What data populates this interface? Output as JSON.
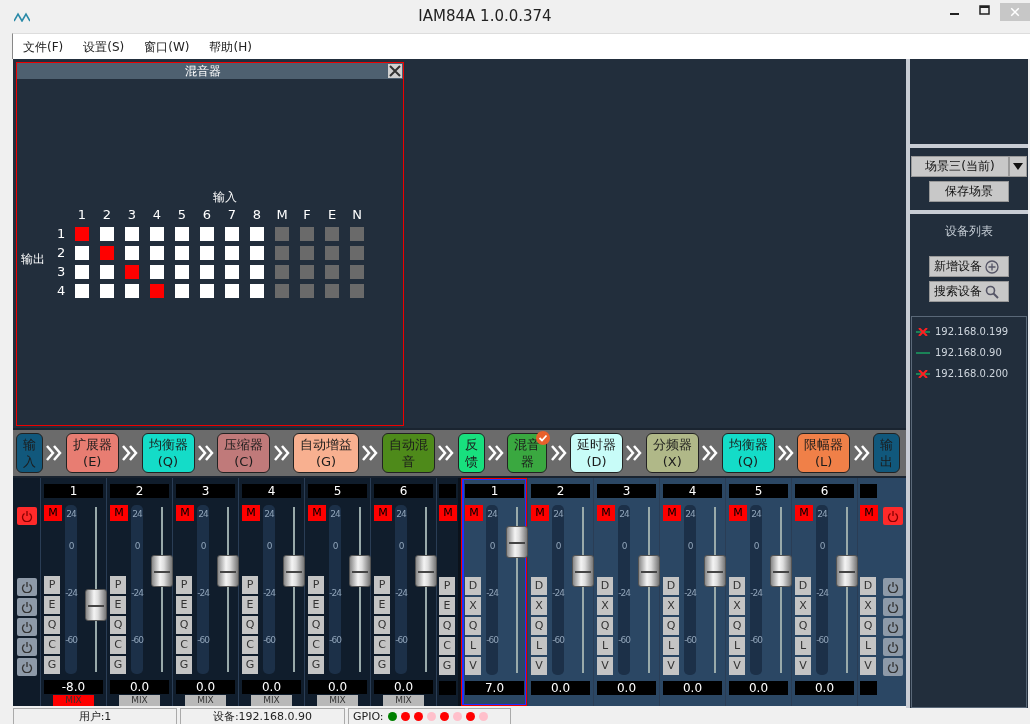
{
  "window": {
    "title": "IAM84A 1.0.0.374"
  },
  "menu": [
    "文件(F)",
    "设置(S)",
    "窗口(W)",
    "帮助(H)"
  ],
  "mixer_panel": {
    "title": "混音器",
    "input_label": "输入",
    "output_label": "输出",
    "columns": [
      "1",
      "2",
      "3",
      "4",
      "5",
      "6",
      "7",
      "8",
      "M",
      "F",
      "E",
      "N"
    ],
    "rows": [
      {
        "label": "1",
        "cells": [
          {
            "on": true,
            "disabled": false
          },
          {
            "on": false,
            "disabled": false
          },
          {
            "on": false,
            "disabled": false
          },
          {
            "on": false,
            "disabled": false
          },
          {
            "on": false,
            "disabled": false
          },
          {
            "on": false,
            "disabled": false
          },
          {
            "on": false,
            "disabled": false
          },
          {
            "on": false,
            "disabled": false
          },
          {
            "disabled": true
          },
          {
            "disabled": true
          },
          {
            "disabled": true
          },
          {
            "disabled": true
          }
        ]
      },
      {
        "label": "2",
        "cells": [
          {
            "on": false,
            "disabled": false
          },
          {
            "on": true,
            "disabled": false
          },
          {
            "on": false,
            "disabled": false
          },
          {
            "on": false,
            "disabled": false
          },
          {
            "on": false,
            "disabled": false
          },
          {
            "on": false,
            "disabled": false
          },
          {
            "on": false,
            "disabled": false
          },
          {
            "on": false,
            "disabled": false
          },
          {
            "disabled": true
          },
          {
            "disabled": true
          },
          {
            "disabled": true
          },
          {
            "disabled": true
          }
        ]
      },
      {
        "label": "3",
        "cells": [
          {
            "on": false,
            "disabled": false
          },
          {
            "on": false,
            "disabled": false
          },
          {
            "on": true,
            "disabled": false
          },
          {
            "on": false,
            "disabled": false
          },
          {
            "on": false,
            "disabled": false
          },
          {
            "on": false,
            "disabled": false
          },
          {
            "on": false,
            "disabled": false
          },
          {
            "on": false,
            "disabled": false
          },
          {
            "disabled": true
          },
          {
            "disabled": true
          },
          {
            "disabled": true
          },
          {
            "disabled": true
          }
        ]
      },
      {
        "label": "4",
        "cells": [
          {
            "on": false,
            "disabled": false
          },
          {
            "on": false,
            "disabled": false
          },
          {
            "on": false,
            "disabled": false
          },
          {
            "on": true,
            "disabled": false
          },
          {
            "on": false,
            "disabled": false
          },
          {
            "on": false,
            "disabled": false
          },
          {
            "on": false,
            "disabled": false
          },
          {
            "on": false,
            "disabled": false
          },
          {
            "disabled": true
          },
          {
            "disabled": true
          },
          {
            "disabled": true
          },
          {
            "disabled": true
          }
        ]
      }
    ]
  },
  "chain": [
    {
      "lines": [
        "输",
        "入"
      ],
      "color": "#11587c",
      "checked": false
    },
    {
      "lines": [
        "扩展器",
        "(E)"
      ],
      "color": "#e87d72",
      "checked": false
    },
    {
      "lines": [
        "均衡器",
        "(Q)"
      ],
      "color": "#14dcc8",
      "checked": false
    },
    {
      "lines": [
        "压缩器",
        "(C)"
      ],
      "color": "#c07a7a",
      "checked": false
    },
    {
      "lines": [
        "自动增益",
        "(G)"
      ],
      "color": "#f8b090",
      "checked": false
    },
    {
      "lines": [
        "自动混",
        "音"
      ],
      "color": "#4e8a1a",
      "checked": false
    },
    {
      "lines": [
        "反",
        "馈"
      ],
      "color": "#18e07e",
      "checked": false
    },
    {
      "lines": [
        "混音",
        "器"
      ],
      "color": "#3aa840",
      "checked": true
    },
    {
      "lines": [
        "延时器",
        "(D)"
      ],
      "color": "#c8fcf8",
      "checked": false
    },
    {
      "lines": [
        "分频器",
        "(X)"
      ],
      "color": "#b0b888",
      "checked": false
    },
    {
      "lines": [
        "均衡器",
        "(Q)"
      ],
      "color": "#14dcc8",
      "checked": false
    },
    {
      "lines": [
        "限幅器",
        "(L)"
      ],
      "color": "#f08048",
      "checked": false
    },
    {
      "lines": [
        "输",
        "出"
      ],
      "color": "#11587c",
      "checked": false
    }
  ],
  "input_strip": {
    "power": [
      {
        "on": true
      },
      {
        "on": false
      },
      {
        "on": false
      },
      {
        "on": false
      },
      {
        "on": false
      },
      {
        "on": false
      }
    ],
    "channels": [
      {
        "kind": "full",
        "number": "1",
        "mute": "M",
        "muted": true,
        "buttons": [
          "P",
          "E",
          "Q",
          "C",
          "G"
        ],
        "scale": [
          "24",
          "0",
          "-24",
          "-60"
        ],
        "level": 0.39,
        "value": "-8.0",
        "mix": {
          "label": "MIX",
          "selected": true
        }
      },
      {
        "kind": "full",
        "number": "2",
        "mute": "M",
        "muted": true,
        "buttons": [
          "P",
          "E",
          "Q",
          "C",
          "G"
        ],
        "scale": [
          "24",
          "0",
          "-24",
          "-60"
        ],
        "level": 0.64,
        "value": "0.0",
        "mix": {
          "label": "MIX",
          "selected": false
        }
      },
      {
        "kind": "full",
        "number": "3",
        "mute": "M",
        "muted": true,
        "buttons": [
          "P",
          "E",
          "Q",
          "C",
          "G"
        ],
        "scale": [
          "24",
          "0",
          "-24",
          "-60"
        ],
        "level": 0.64,
        "value": "0.0",
        "mix": {
          "label": "MIX",
          "selected": false
        }
      },
      {
        "kind": "full",
        "number": "4",
        "mute": "M",
        "muted": true,
        "buttons": [
          "P",
          "E",
          "Q",
          "C",
          "G"
        ],
        "scale": [
          "24",
          "0",
          "-24",
          "-60"
        ],
        "level": 0.64,
        "value": "0.0",
        "mix": {
          "label": "MIX",
          "selected": false
        }
      },
      {
        "kind": "full",
        "number": "5",
        "mute": "M",
        "muted": true,
        "buttons": [
          "P",
          "E",
          "Q",
          "C",
          "G"
        ],
        "scale": [
          "24",
          "0",
          "-24",
          "-60"
        ],
        "level": 0.64,
        "value": "0.0",
        "mix": {
          "label": "MIX",
          "selected": false
        }
      },
      {
        "kind": "full",
        "number": "6",
        "mute": "M",
        "muted": true,
        "buttons": [
          "P",
          "E",
          "Q",
          "C",
          "G"
        ],
        "scale": [
          "24",
          "0",
          "-24",
          "-60"
        ],
        "level": 0.64,
        "value": "0.0",
        "mix": {
          "label": "MIX",
          "selected": false
        }
      },
      {
        "kind": "partial",
        "mute": "M",
        "muted": true,
        "buttons": [
          "P",
          "E",
          "Q",
          "C",
          "G"
        ]
      }
    ]
  },
  "output_strip": {
    "power": [
      {
        "on": true
      },
      {
        "on": false
      },
      {
        "on": false
      },
      {
        "on": false
      },
      {
        "on": false
      },
      {
        "on": false
      }
    ],
    "channels": [
      {
        "kind": "full",
        "number": "1",
        "selected": true,
        "mute": "M",
        "muted": true,
        "buttons": [
          "D",
          "X",
          "Q",
          "L",
          "V"
        ],
        "scale": [
          "24",
          "0",
          "-24",
          "-60"
        ],
        "level": 0.85,
        "value": "7.0"
      },
      {
        "kind": "full",
        "number": "2",
        "selected": false,
        "mute": "M",
        "muted": true,
        "buttons": [
          "D",
          "X",
          "Q",
          "L",
          "V"
        ],
        "scale": [
          "24",
          "0",
          "-24",
          "-60"
        ],
        "level": 0.64,
        "value": "0.0"
      },
      {
        "kind": "full",
        "number": "3",
        "selected": false,
        "mute": "M",
        "muted": true,
        "buttons": [
          "D",
          "X",
          "Q",
          "L",
          "V"
        ],
        "scale": [
          "24",
          "0",
          "-24",
          "-60"
        ],
        "level": 0.64,
        "value": "0.0"
      },
      {
        "kind": "full",
        "number": "4",
        "selected": false,
        "mute": "M",
        "muted": true,
        "buttons": [
          "D",
          "X",
          "Q",
          "L",
          "V"
        ],
        "scale": [
          "24",
          "0",
          "-24",
          "-60"
        ],
        "level": 0.64,
        "value": "0.0"
      },
      {
        "kind": "full",
        "number": "5",
        "selected": false,
        "mute": "M",
        "muted": true,
        "buttons": [
          "D",
          "X",
          "Q",
          "L",
          "V"
        ],
        "scale": [
          "24",
          "0",
          "-24",
          "-60"
        ],
        "level": 0.64,
        "value": "0.0"
      },
      {
        "kind": "full",
        "number": "6",
        "selected": false,
        "mute": "M",
        "muted": true,
        "buttons": [
          "D",
          "X",
          "Q",
          "L",
          "V"
        ],
        "scale": [
          "24",
          "0",
          "-24",
          "-60"
        ],
        "level": 0.64,
        "value": "0.0"
      },
      {
        "kind": "partial",
        "mute": "M",
        "muted": true,
        "buttons": [
          "D",
          "X",
          "Q",
          "L",
          "V"
        ]
      }
    ]
  },
  "side_panel": {
    "scene": "场景三(当前)",
    "save_button": "保存场景",
    "device_list_title": "设备列表",
    "add_button": "新增设备",
    "search_button": "搜索设备",
    "devices": [
      {
        "ip": "192.168.0.199",
        "online": false
      },
      {
        "ip": "192.168.0.90",
        "online": true
      },
      {
        "ip": "192.168.0.200",
        "online": false
      }
    ]
  },
  "status_bar": {
    "user": "用户:1",
    "device": "设备:192.168.0.90",
    "gpio_label": "GPIO:",
    "gpio": [
      {
        "color": "#008000"
      },
      {
        "color": "#ff0000"
      },
      {
        "color": "#ff0000"
      },
      {
        "color": "#ffc0cb"
      },
      {
        "color": "#ff0000"
      },
      {
        "color": "#ffc0cb"
      },
      {
        "color": "#ff0000"
      },
      {
        "color": "#ffc0cb"
      }
    ]
  }
}
